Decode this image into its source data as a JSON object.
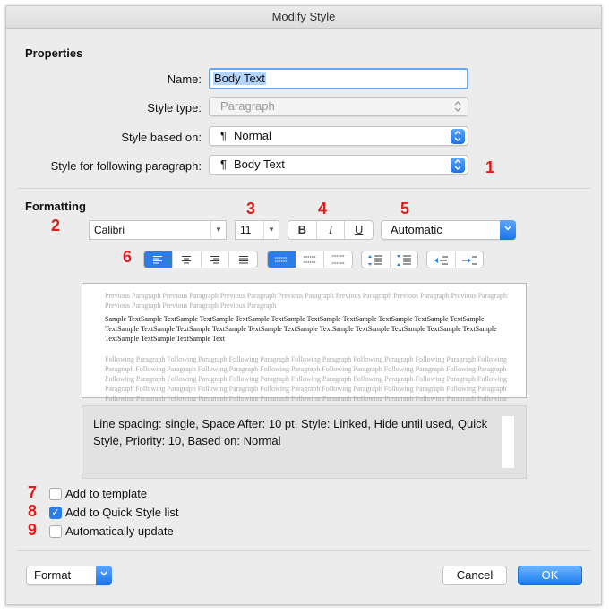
{
  "window": {
    "title": "Modify Style"
  },
  "properties": {
    "section_title": "Properties",
    "name_label": "Name:",
    "name_value": "Body Text",
    "style_type_label": "Style type:",
    "style_type_value": "Paragraph",
    "based_on_label": "Style based on:",
    "based_on_value": "Normal",
    "following_label": "Style for following paragraph:",
    "following_value": "Body Text"
  },
  "formatting": {
    "section_title": "Formatting",
    "font": "Calibri",
    "size": "11",
    "bold": "B",
    "italic": "I",
    "underline": "U",
    "color": "Automatic",
    "alignment_selected": "left",
    "line_spacing_selected": "single"
  },
  "preview": {
    "previous": "Previous Paragraph Previous Paragraph Previous Paragraph Previous Paragraph Previous Paragraph Previous Paragraph Previous Paragraph Previous Paragraph Previous Paragraph Previous Paragraph",
    "sample": "Sample TextSample TextSample TextSample TextSample TextSample TextSample TextSample TextSample TextSample TextSample TextSample TextSample TextSample TextSample TextSample TextSample TextSample TextSample TextSample TextSample TextSample TextSample TextSample TextSample Text",
    "following": "Following Paragraph Following Paragraph Following Paragraph Following Paragraph Following Paragraph Following Paragraph Following Paragraph Following Paragraph Following Paragraph Following Paragraph Following Paragraph Following Paragraph Following Paragraph Following Paragraph Following Paragraph Following Paragraph Following Paragraph Following Paragraph Following Paragraph Following Paragraph Following Paragraph Following Paragraph Following Paragraph Following Paragraph Following Paragraph Following Paragraph Following Paragraph Following Paragraph Following Paragraph Following Paragraph Following Paragraph Following Paragraph Following Paragraph Following Paragraph Following Paragraph Following Paragraph"
  },
  "description": "Line spacing:  single, Space After:  10 pt, Style: Linked, Hide until used, Quick Style, Priority: 10, Based on: Normal",
  "options": {
    "add_to_template": {
      "label": "Add to template",
      "checked": false
    },
    "add_to_quick_style": {
      "label": "Add to Quick Style list",
      "checked": true
    },
    "auto_update": {
      "label": "Automatically update",
      "checked": false
    }
  },
  "footer": {
    "format_label": "Format",
    "cancel_label": "Cancel",
    "ok_label": "OK"
  },
  "annotations": {
    "n1": "1",
    "n2": "2",
    "n3": "3",
    "n4": "4",
    "n5": "5",
    "n6": "6",
    "n7": "7",
    "n8": "8",
    "n9": "9"
  },
  "colors": {
    "accent": "#2c7de6",
    "annotation": "#e01b1b",
    "dialog_bg": "#ececec"
  },
  "icons": {
    "pilcrow": "¶",
    "check": "✓",
    "chevron_updown": "⌃⌄",
    "chevron_down": "▾",
    "align_left": "align-left-icon",
    "align_center": "align-center-icon",
    "align_right": "align-right-icon",
    "justify": "justify-icon",
    "spacing": "line-spacing-icon",
    "indent": "indent-icon"
  }
}
